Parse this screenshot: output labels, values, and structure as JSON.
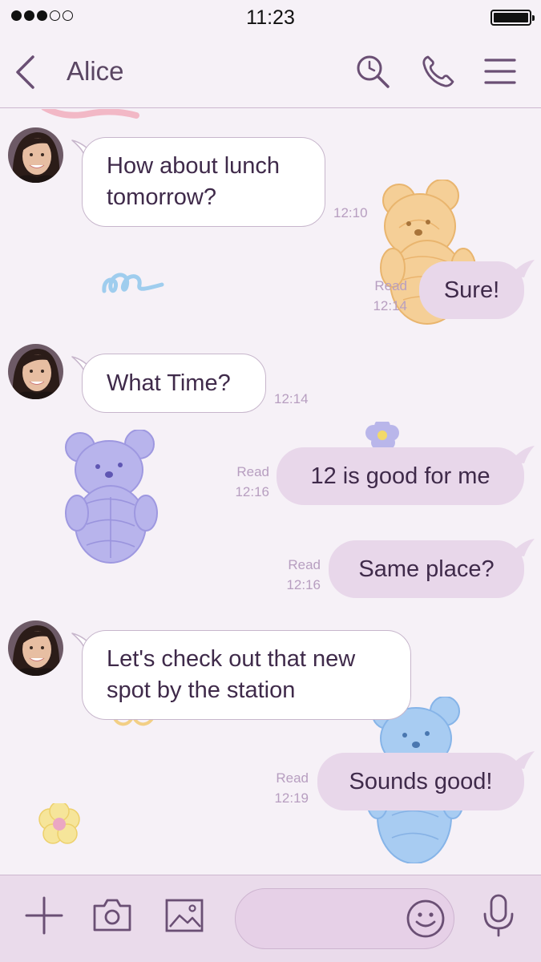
{
  "status_bar": {
    "time": "11:23"
  },
  "header": {
    "title": "Alice"
  },
  "messages": [
    {
      "direction": "in",
      "lines": [
        "How about lunch",
        "tomorrow?"
      ],
      "time": "12:10"
    },
    {
      "direction": "out",
      "text": "Sure!",
      "read": "Read",
      "time": "12:14"
    },
    {
      "direction": "in",
      "text": "What Time?",
      "time": "12:14"
    },
    {
      "direction": "out",
      "text": "12 is good for me",
      "read": "Read",
      "time": "12:16"
    },
    {
      "direction": "out",
      "text": "Same place?",
      "read": "Read",
      "time": "12:16"
    },
    {
      "direction": "in",
      "lines": [
        "Let's check out that new",
        "spot by the station"
      ]
    },
    {
      "direction": "out",
      "text": "Sounds good!",
      "read": "Read",
      "time": "12:19"
    }
  ],
  "composer": {
    "value": "",
    "placeholder": ""
  },
  "icons": {
    "back": "chevron-left-icon",
    "search": "search-icon",
    "call": "phone-icon",
    "menu": "hamburger-menu-icon",
    "add": "plus-icon",
    "camera": "camera-icon",
    "gallery": "image-icon",
    "emoji": "smiley-icon",
    "voice": "microphone-icon"
  },
  "colors": {
    "accent": "#6a4f74",
    "outgoing_bubble": "#e8d7ea",
    "incoming_bubble": "#ffffff",
    "background": "#f6f1f7",
    "timestamp": "#b79ec0"
  }
}
